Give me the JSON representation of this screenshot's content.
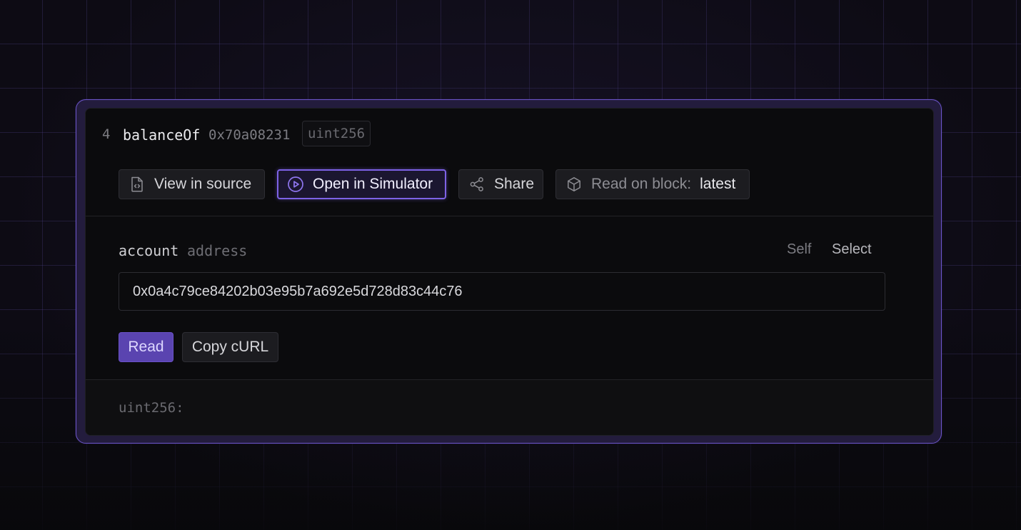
{
  "function": {
    "index": "4",
    "name": "balanceOf",
    "selector": "0x70a08231",
    "return_type": "uint256"
  },
  "toolbar": {
    "view_source_label": "View in source",
    "open_simulator_label": "Open in Simulator",
    "share_label": "Share",
    "read_on_block_label": "Read on block:",
    "read_on_block_value": "latest",
    "icons": {
      "view_source": "file-code-icon",
      "open_simulator": "play-circle-icon",
      "share": "share-icon",
      "read_on_block": "cube-icon"
    }
  },
  "inputs": {
    "param_name": "account",
    "param_type": "address",
    "self_label": "Self",
    "select_label": "Select",
    "address_value": "0x0a4c79ce84202b03e95b7a692e5d728d83c44c76",
    "read_label": "Read",
    "copy_curl_label": "Copy cURL"
  },
  "output": {
    "label": "uint256:"
  },
  "colors": {
    "accent": "#7d62e6",
    "read_button": "#5a44b0",
    "card_bg": "#0b0b0d",
    "frame_bg": "#231c3d"
  }
}
